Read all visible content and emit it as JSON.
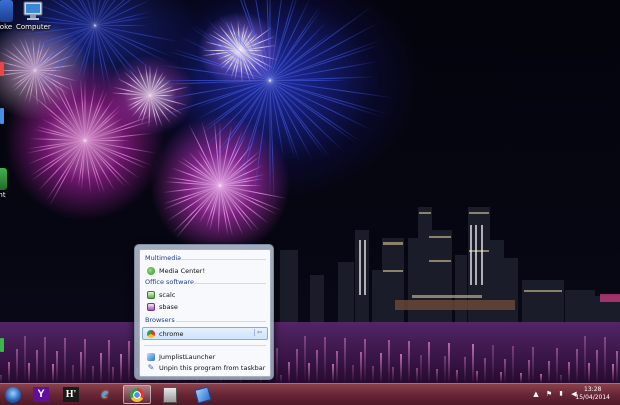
{
  "desktop": {
    "icons": [
      {
        "label": "oke",
        "icon": "app-icon"
      },
      {
        "label": "Computer",
        "icon": "computer-icon"
      },
      {
        "label": "nt",
        "icon": "app-icon"
      }
    ]
  },
  "jumplist": {
    "categories": [
      {
        "name": "Multimedia",
        "items": [
          {
            "label": "Media Center!",
            "icon": "media-center-icon"
          }
        ]
      },
      {
        "name": "Office software",
        "items": [
          {
            "label": "scalc",
            "icon": "calc-icon"
          },
          {
            "label": "sbase",
            "icon": "base-icon"
          }
        ]
      },
      {
        "name": "Browsers",
        "items": [
          {
            "label": "chrome",
            "icon": "chrome-icon",
            "selected": true
          }
        ]
      }
    ],
    "tasks": [
      {
        "label": "JumplistLauncher",
        "icon": "jumplist-launcher-icon"
      },
      {
        "label": "Unpin this program from taskbar",
        "icon": "unpin-icon"
      }
    ]
  },
  "taskbar": {
    "buttons": [
      {
        "name": "start-orb",
        "icon": "windows-logo-icon"
      },
      {
        "name": "yahoo",
        "glyph": "Y",
        "color": "#5f0f99"
      },
      {
        "name": "hootsuite",
        "glyph": "H'",
        "color": "#ffffff"
      },
      {
        "name": "internet-explorer",
        "glyph": "e",
        "color": "#1e7de0"
      },
      {
        "name": "chrome",
        "icon": "chrome-icon",
        "active": true
      },
      {
        "name": "jumplist-launcher",
        "icon": "jumplist-launcher-icon"
      },
      {
        "name": "notebook",
        "icon": "notebook-icon"
      }
    ],
    "clock": {
      "time": "13:28",
      "date": "15/04/2014"
    }
  },
  "colors": {
    "taskbar": "#7a2a3c",
    "accent": "#1e3d8f",
    "selection": "#cfe3fb"
  }
}
